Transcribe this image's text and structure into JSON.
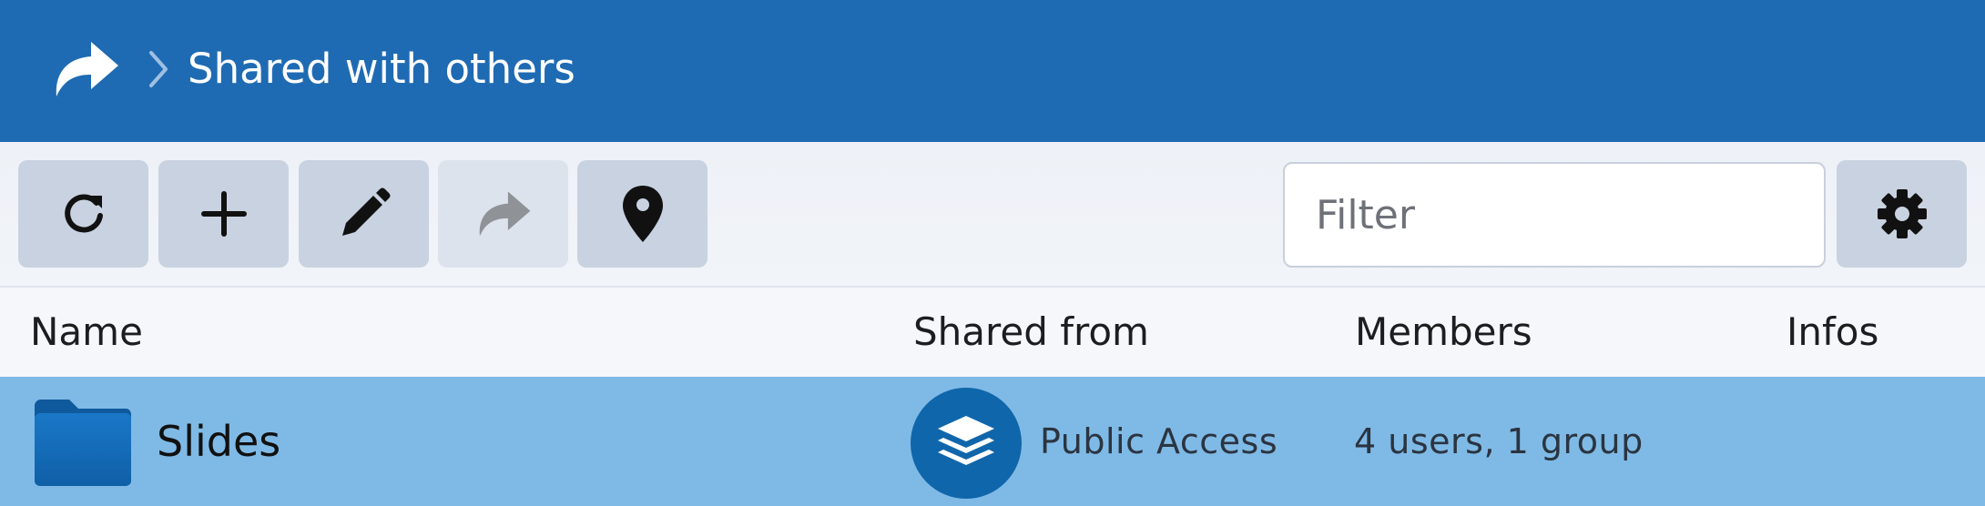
{
  "header": {
    "icon": "share-arrow-icon",
    "separator_icon": "chevron-right-icon",
    "title": "Shared with others"
  },
  "toolbar": {
    "buttons": [
      {
        "icon": "refresh-icon",
        "enabled": true
      },
      {
        "icon": "plus-icon",
        "enabled": true
      },
      {
        "icon": "pencil-icon",
        "enabled": true
      },
      {
        "icon": "share-arrow-icon",
        "enabled": false
      },
      {
        "icon": "location-pin-icon",
        "enabled": true
      }
    ],
    "filter_placeholder": "Filter",
    "filter_value": "",
    "settings_icon": "gear-icon"
  },
  "table": {
    "columns": [
      "Name",
      "Shared from",
      "Members",
      "Infos"
    ],
    "rows": [
      {
        "icon": "folder-icon",
        "name": "Slides",
        "shared_from_icon": "layers-icon",
        "shared_from": "Public Access",
        "members": "4 users, 1 group",
        "infos": "",
        "selected": true
      }
    ]
  },
  "colors": {
    "header_bg": "#1f6bb3",
    "button_bg": "#c9d2e0",
    "selected_row_bg": "#7fbae6",
    "badge_bg": "#1066ab"
  }
}
